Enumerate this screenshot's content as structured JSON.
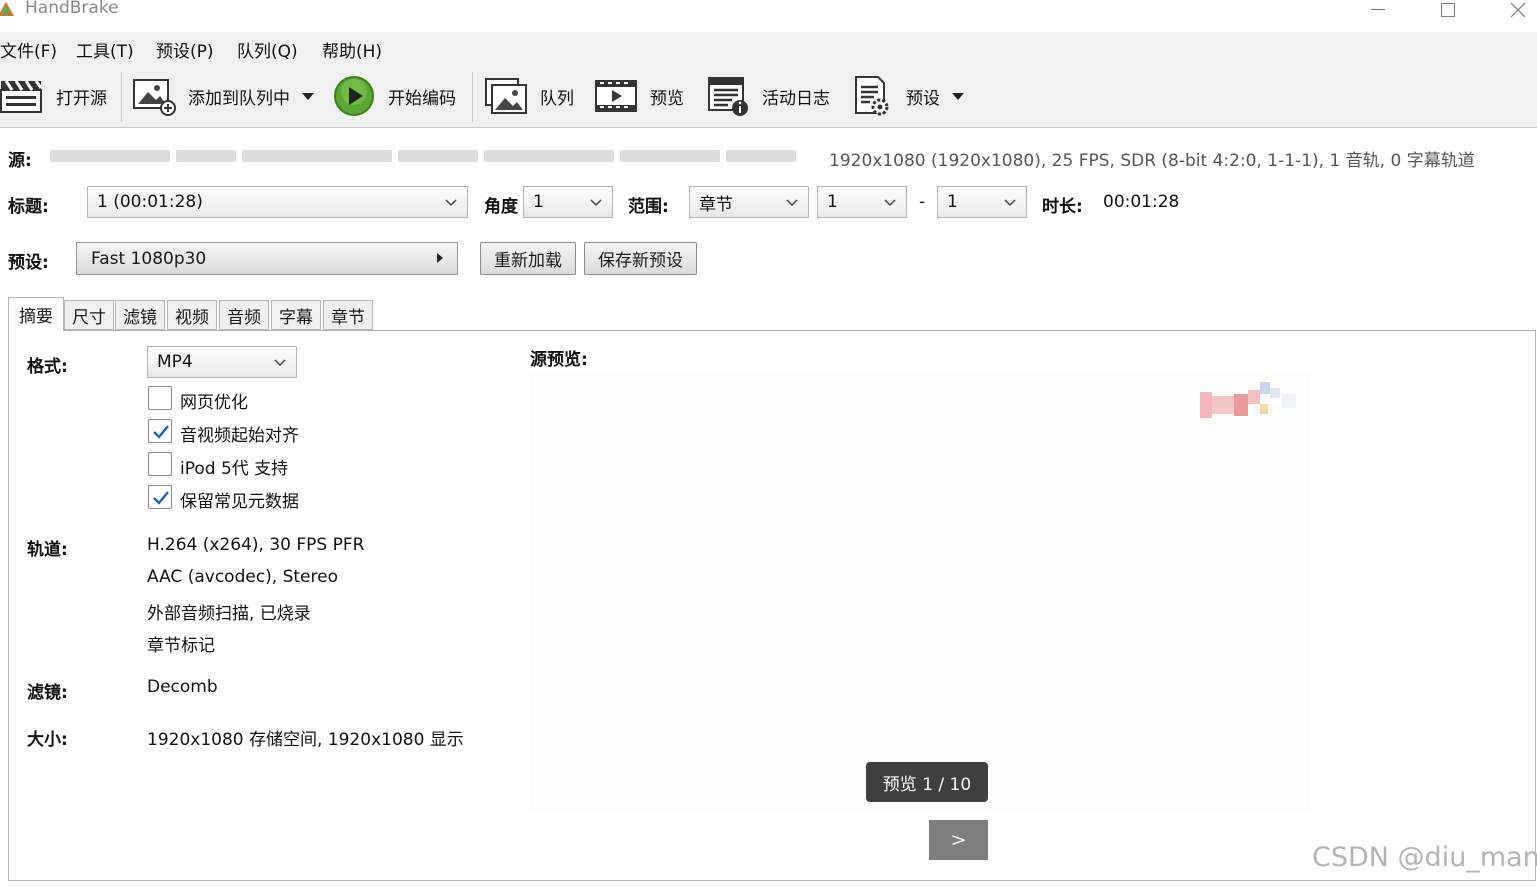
{
  "window": {
    "title": "HandBrake"
  },
  "menu": [
    "文件(F)",
    "工具(T)",
    "预设(P)",
    "队列(Q)",
    "帮助(H)"
  ],
  "toolbar": {
    "open_source": "打开源",
    "add_to_queue": "添加到队列中",
    "start_encode": "开始编码",
    "queue": "队列",
    "preview": "预览",
    "activity_log": "活动日志",
    "presets": "预设"
  },
  "source": {
    "label": "源:",
    "info": "1920x1080 (1920x1080), 25 FPS, SDR (8-bit 4:2:0, 1-1-1), 1 音轨, 0 字幕轨道"
  },
  "title_row": {
    "title_label": "标题:",
    "title_value": "1  (00:01:28)",
    "angle_label": "角度",
    "angle_value": "1",
    "range_label": "范围:",
    "range_value": "章节",
    "range_start": "1",
    "range_dash": "-",
    "range_end": "1",
    "duration_label": "时长:",
    "duration_value": "00:01:28"
  },
  "preset_row": {
    "label": "预设:",
    "value": "Fast 1080p30",
    "reload": "重新加载",
    "save_new": "保存新预设"
  },
  "tabs": [
    "摘要",
    "尺寸",
    "滤镜",
    "视频",
    "音频",
    "字幕",
    "章节"
  ],
  "summary": {
    "format_label": "格式:",
    "format_value": "MP4",
    "options": [
      {
        "label": "网页优化",
        "checked": false
      },
      {
        "label": "音视频起始对齐",
        "checked": true
      },
      {
        "label": "iPod 5代 支持",
        "checked": false
      },
      {
        "label": "保留常见元数据",
        "checked": true
      }
    ],
    "tracks_label": "轨道:",
    "tracks": [
      "H.264 (x264), 30 FPS PFR",
      "AAC (avcodec), Stereo",
      "外部音频扫描, 已烧录",
      "章节标记"
    ],
    "filters_label": "滤镜:",
    "filters_value": "Decomb",
    "size_label": "大小:",
    "size_value": "1920x1080 存储空间, 1920x1080 显示"
  },
  "preview": {
    "label": "源预览:",
    "counter": "预览 1 / 10",
    "next": ">"
  },
  "watermark": "CSDN @diu_man"
}
